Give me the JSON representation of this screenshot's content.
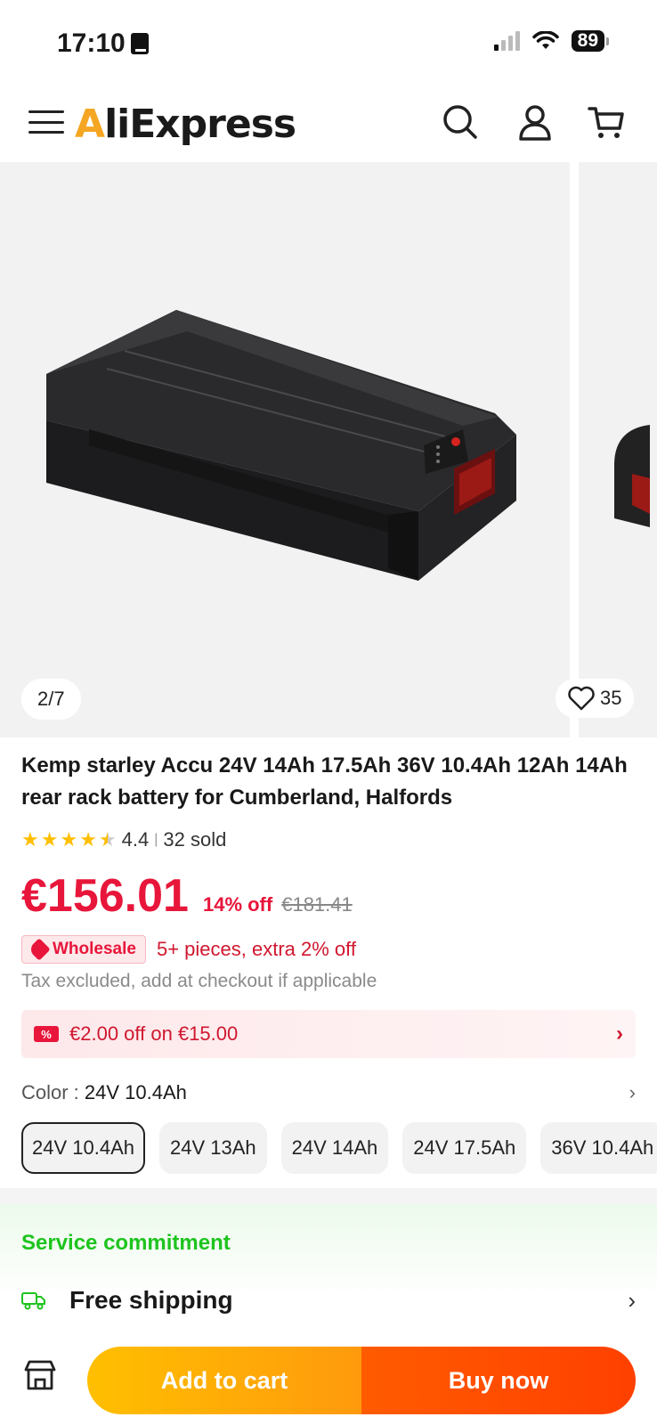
{
  "status_bar": {
    "time": "17:10",
    "battery": "89"
  },
  "header": {
    "logo_prefix": "A",
    "logo_rest": "liExpress"
  },
  "gallery": {
    "counter": "2/7",
    "wishlist_count": "35"
  },
  "product": {
    "title": "Kemp starley Accu 24V 14Ah 17.5Ah 36V 10.4Ah 12Ah 14Ah rear rack battery for Cumberland, Halfords",
    "rating": "4.4",
    "rating_value": 4.4,
    "sold": "32 sold",
    "price": "€156.01",
    "discount": "14% off",
    "original_price": "€181.41",
    "wholesale_label": "Wholesale",
    "wholesale_note": "5+ pieces, extra 2% off",
    "tax_note": "Tax excluded, add at checkout if applicable",
    "coupon": "€2.00 off on €15.00",
    "color_label": "Color : ",
    "color_value": "24V 10.4Ah",
    "options": [
      "24V 10.4Ah",
      "24V 13Ah",
      "24V 14Ah",
      "24V 17.5Ah",
      "36V 10.4Ah"
    ]
  },
  "service": {
    "title": "Service commitment",
    "shipping": "Free shipping"
  },
  "bottom": {
    "add_to_cart": "Add to cart",
    "buy_now": "Buy now"
  },
  "colors": {
    "accent_red": "#e8163b",
    "star": "#ffbf00",
    "service_green": "#1ec41e",
    "cart_orange": "#ffbf00",
    "buy_orange": "#ff4d00"
  }
}
